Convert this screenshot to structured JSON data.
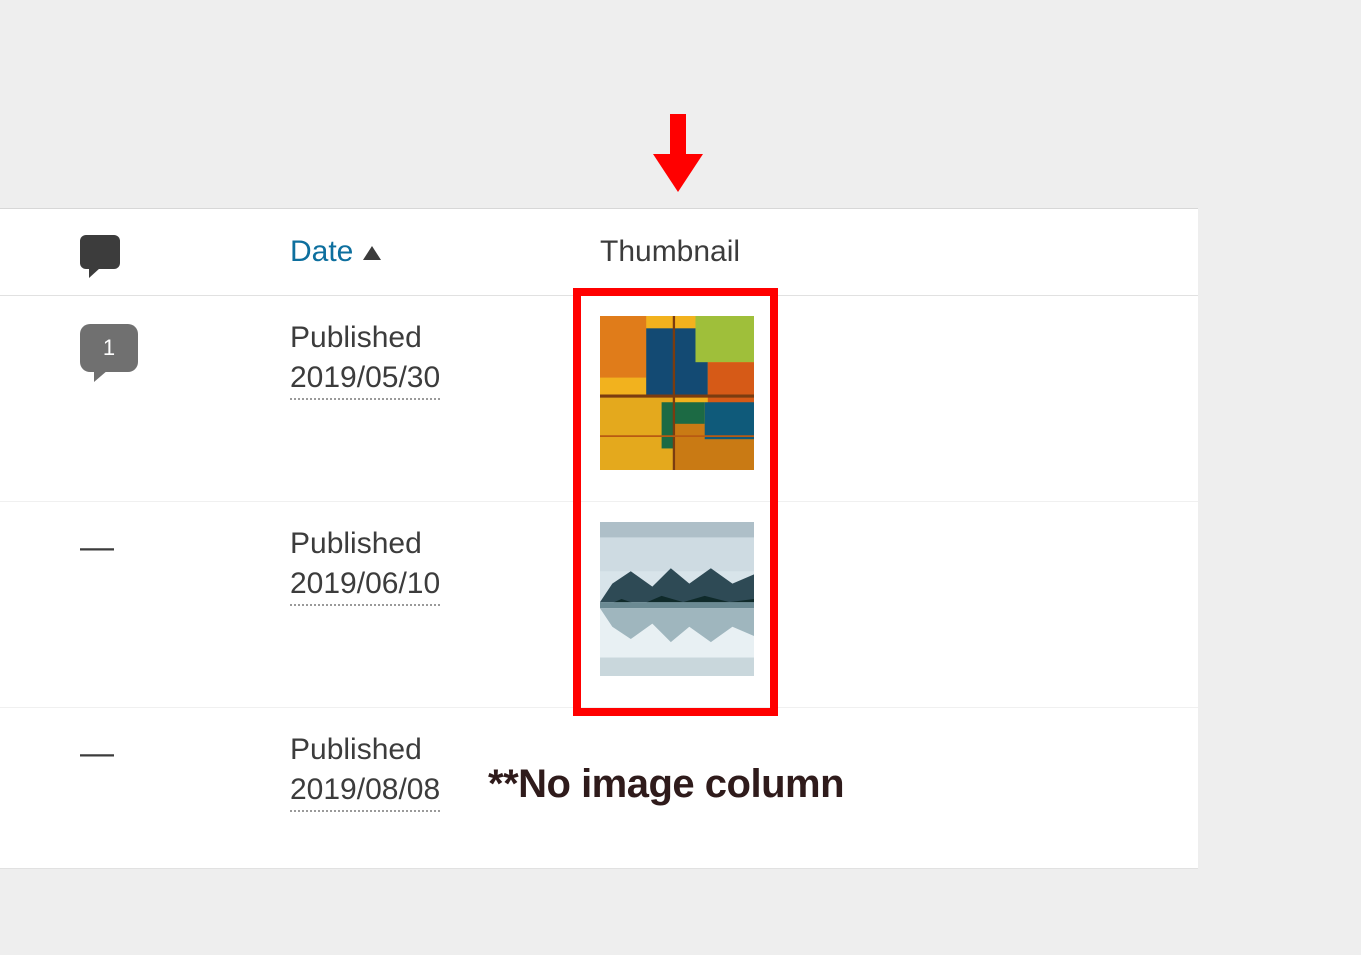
{
  "columns": {
    "date_label": "Date",
    "thumbnail_label": "Thumbnail"
  },
  "rows": [
    {
      "comments": "1",
      "status": "Published",
      "date": "2019/05/30",
      "thumb": "abstract-painting"
    },
    {
      "comments": "—",
      "status": "Published",
      "date": "2019/06/10",
      "thumb": "mountain-lake"
    },
    {
      "comments": "—",
      "status": "Published",
      "date": "2019/08/08",
      "thumb": null
    }
  ],
  "annotation": {
    "text": "**No image column",
    "arrow_color": "#ff0000",
    "box_color": "#ff0000"
  }
}
